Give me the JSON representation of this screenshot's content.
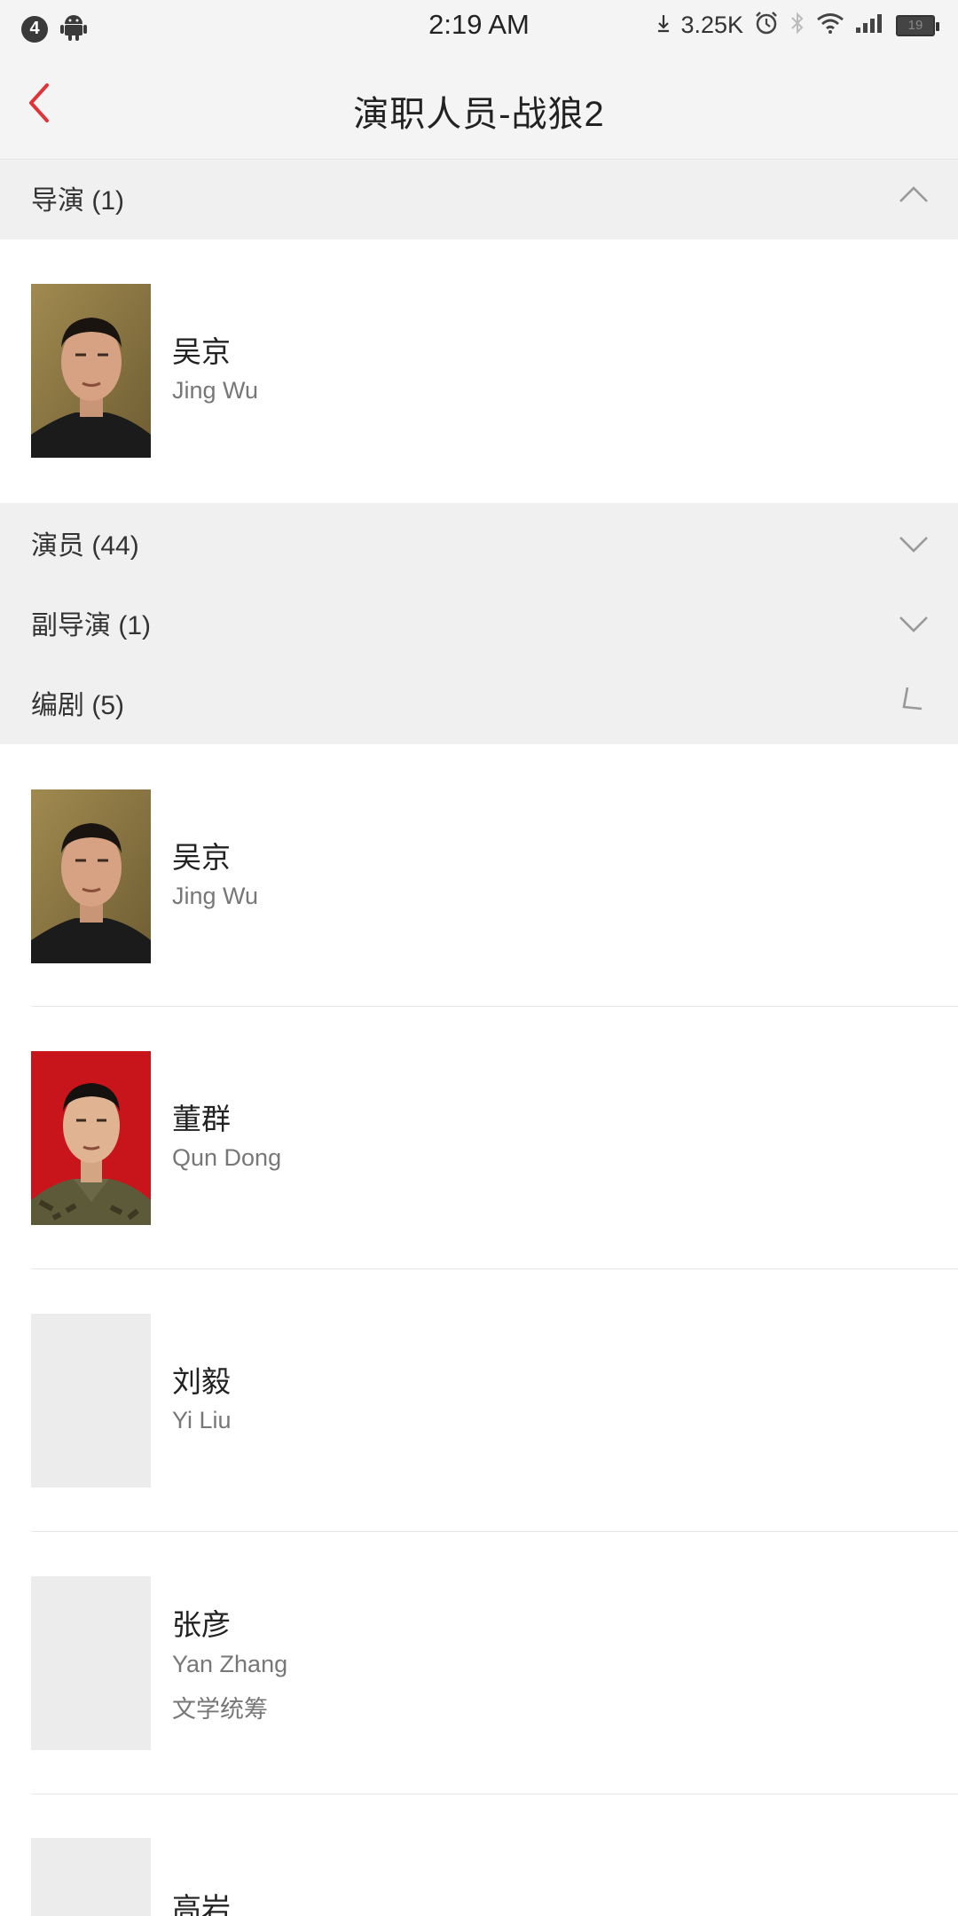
{
  "status_bar": {
    "notification_count": "4",
    "time": "2:19 AM",
    "net_speed": "3.25K",
    "battery_level": "19",
    "icons": [
      "android-icon",
      "download-icon",
      "alarm-icon",
      "bluetooth-icon",
      "wifi-icon",
      "signal-icon",
      "battery-icon"
    ]
  },
  "header": {
    "title": "演职人员-战狼2",
    "back_icon": "chevron-left-icon",
    "accent_color": "#e0343a"
  },
  "sections": {
    "director": {
      "label": "导演 (1)",
      "state": "expanded"
    },
    "cast": {
      "label": "演员 (44)",
      "state": "collapsed"
    },
    "assistant_director": {
      "label": "副导演 (1)",
      "state": "collapsed"
    },
    "screenwriter": {
      "label": "编剧 (5)",
      "state": "expanded"
    }
  },
  "directors": [
    {
      "name": "吴京",
      "en": "Jing Wu",
      "photo": "portrait"
    }
  ],
  "screenwriters": [
    {
      "name": "吴京",
      "en": "Jing Wu",
      "photo": "portrait"
    },
    {
      "name": "董群",
      "en": "Qun Dong",
      "photo": "portrait-red"
    },
    {
      "name": "刘毅",
      "en": "Yi Liu",
      "photo": "placeholder"
    },
    {
      "name": "张彦",
      "en": "Yan Zhang",
      "role": "文学统筹",
      "photo": "placeholder"
    },
    {
      "name": "高岩",
      "photo": "placeholder"
    }
  ]
}
